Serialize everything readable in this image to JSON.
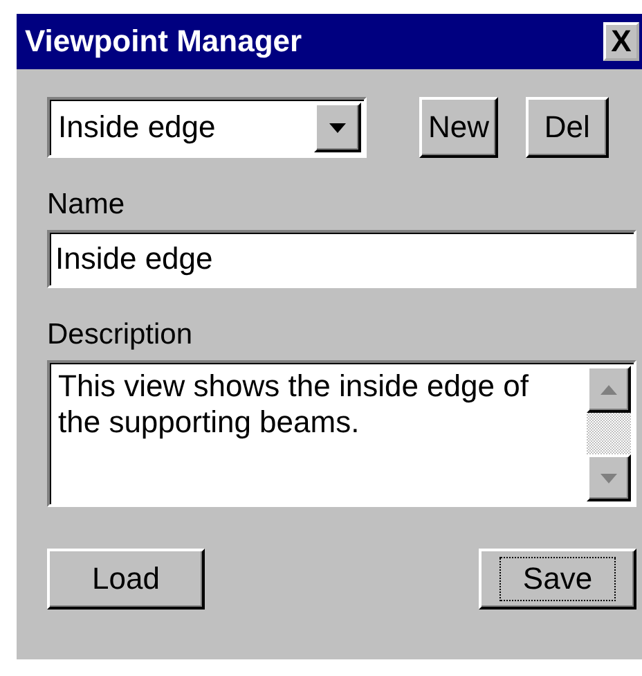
{
  "window": {
    "title": "Viewpoint Manager",
    "close": "X"
  },
  "viewpoint_select": {
    "value": "Inside edge"
  },
  "buttons_top": [
    {
      "label": "New"
    },
    {
      "label": "Del"
    }
  ],
  "name": {
    "label": "Name",
    "value": "Inside edge"
  },
  "description": {
    "label": "Description",
    "value": "This view shows the inside edge of the supporting beams."
  },
  "buttons_bottom": [
    {
      "label": "Load",
      "focused": false
    },
    {
      "label": "Save",
      "focused": true
    }
  ]
}
